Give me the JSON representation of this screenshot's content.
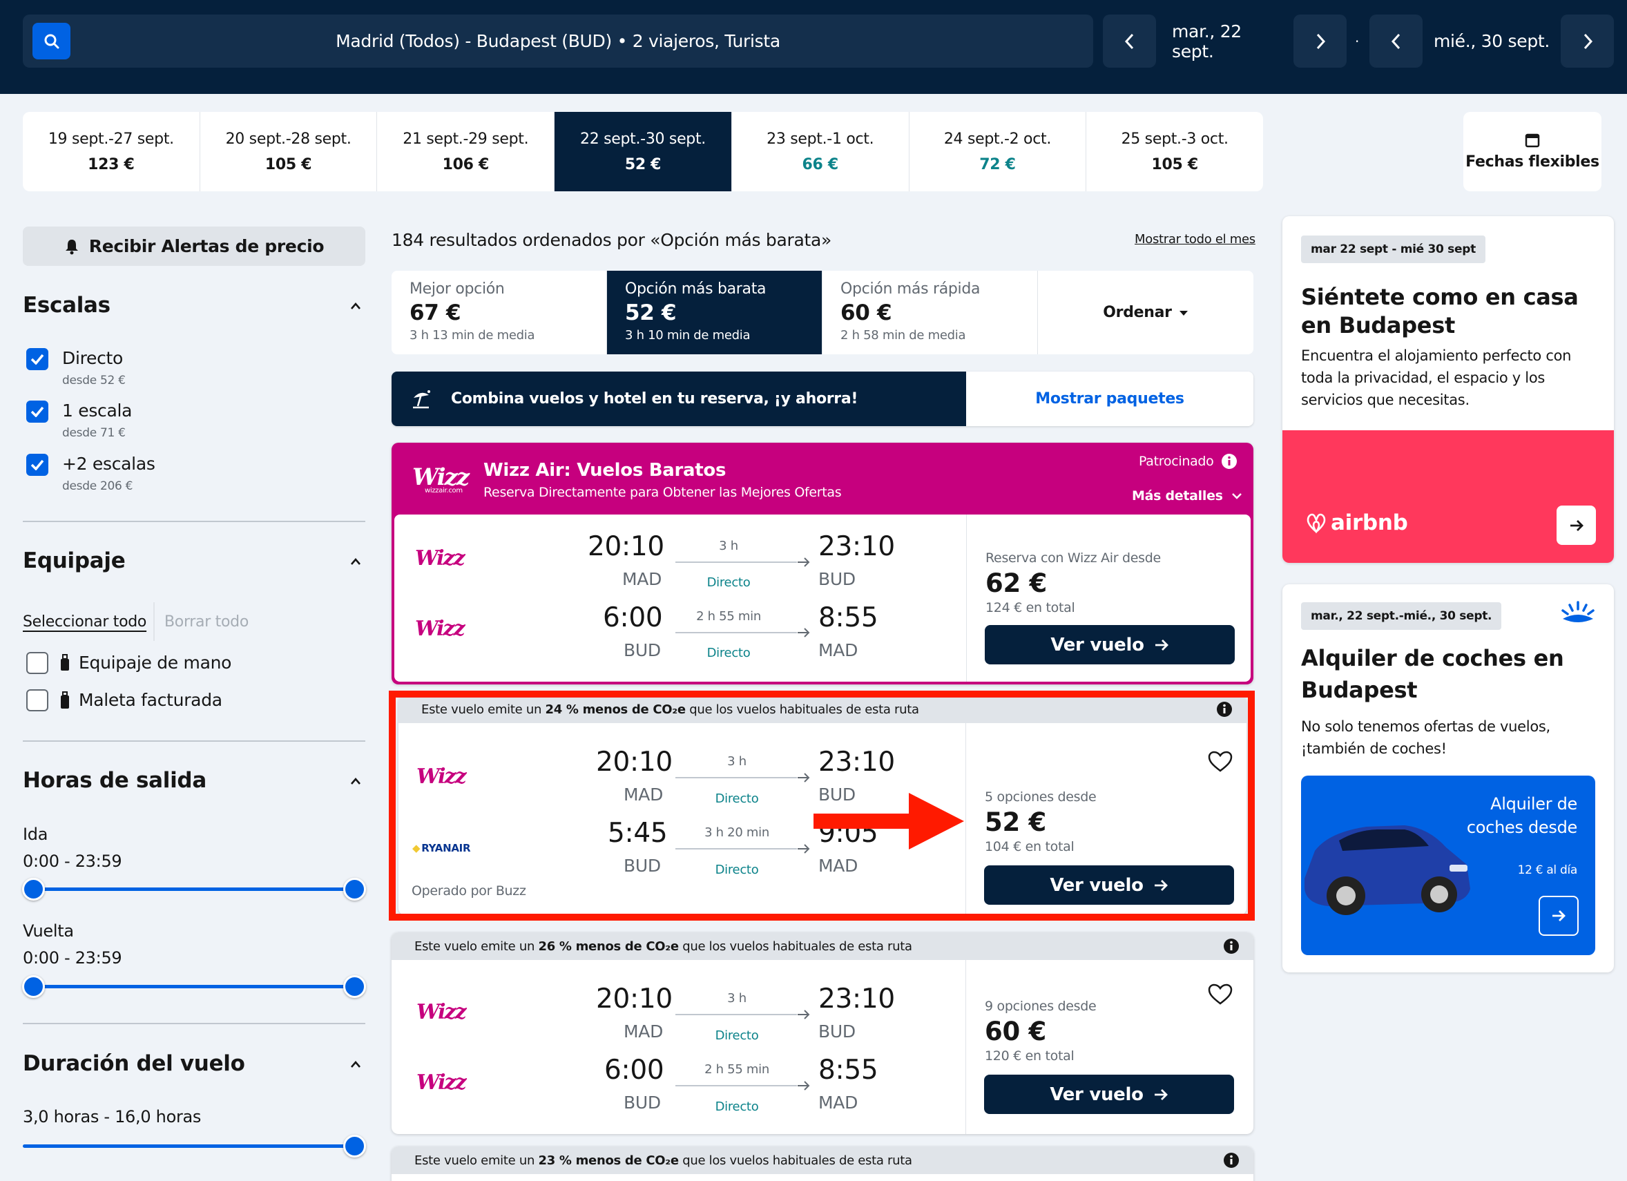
{
  "header": {
    "search_text": "Madrid (Todos) - Budapest (BUD)  •  2 viajeros, Turista",
    "depart_date": "mar., 22 sept.",
    "return_date": "mié., 30 sept.",
    "separator": "·"
  },
  "date_tabs": [
    {
      "range": "19 sept.-27 sept.",
      "price": "123 €",
      "selected": false,
      "cheap": false
    },
    {
      "range": "20 sept.-28 sept.",
      "price": "105 €",
      "selected": false,
      "cheap": false
    },
    {
      "range": "21 sept.-29 sept.",
      "price": "106 €",
      "selected": false,
      "cheap": false
    },
    {
      "range": "22 sept.-30 sept.",
      "price": "52 €",
      "selected": true,
      "cheap": false
    },
    {
      "range": "23 sept.-1 oct.",
      "price": "66 €",
      "selected": false,
      "cheap": true
    },
    {
      "range": "24 sept.-2 oct.",
      "price": "72 €",
      "selected": false,
      "cheap": true
    },
    {
      "range": "25 sept.-3 oct.",
      "price": "105 €",
      "selected": false,
      "cheap": false
    }
  ],
  "flexible_dates_label": "Fechas flexibles",
  "sidebar": {
    "alert_label": "Recibir Alertas de precio",
    "stops": {
      "title": "Escalas",
      "items": [
        {
          "label": "Directo",
          "sub": "desde 52 €",
          "checked": true
        },
        {
          "label": "1 escala",
          "sub": "desde 71 €",
          "checked": true
        },
        {
          "label": "+2 escalas",
          "sub": "desde 206 €",
          "checked": true
        }
      ]
    },
    "baggage": {
      "title": "Equipaje",
      "select_all": "Seleccionar todo",
      "clear_all": "Borrar todo",
      "items": [
        {
          "label": "Equipaje de mano",
          "checked": false
        },
        {
          "label": "Maleta facturada",
          "checked": false
        }
      ]
    },
    "departure_times": {
      "title": "Horas de salida",
      "outbound_label": "Ida",
      "outbound_range": "0:00 - 23:59",
      "return_label": "Vuelta",
      "return_range": "0:00 - 23:59"
    },
    "duration": {
      "title": "Duración del vuelo",
      "range": "3,0 horas - 16,0 horas"
    }
  },
  "results": {
    "summary": "184 resultados ordenados por «Opción más barata»",
    "show_month": "Mostrar todo el mes",
    "sort_tabs": [
      {
        "title": "Mejor opción",
        "price": "67 €",
        "sub": "3 h 13 min de media"
      },
      {
        "title": "Opción más barata",
        "price": "52 €",
        "sub": "3 h 10 min de media"
      },
      {
        "title": "Opción más rápida",
        "price": "60 €",
        "sub": "2 h 58 min de media"
      }
    ],
    "order_label": "Ordenar",
    "combo_text": "Combina vuelos y hotel en tu reserva, ¡y ahorra!",
    "combo_button": "Mostrar paquetes"
  },
  "sponsored": {
    "logo": "Wizz",
    "logo_sub": "wizzair.com",
    "title": "Wizz Air: Vuelos Baratos",
    "subtitle": "Reserva Directamente para Obtener las Mejores Ofertas",
    "tag": "Patrocinado",
    "more_details": "Más detalles",
    "outbound": {
      "dep": "20:10",
      "dep_ap": "MAD",
      "dur": "3 h",
      "type": "Directo",
      "arr": "23:10",
      "arr_ap": "BUD"
    },
    "inbound": {
      "dep": "6:00",
      "dep_ap": "BUD",
      "dur": "2 h 55 min",
      "type": "Directo",
      "arr": "8:55",
      "arr_ap": "MAD"
    },
    "price_from": "Reserva con Wizz Air desde",
    "price": "62 €",
    "total": "124 € en total",
    "button": "Ver vuelo"
  },
  "flights": [
    {
      "eco": [
        "Este vuelo emite un ",
        "24 % menos de CO₂e",
        " que los vuelos habituales de esta ruta"
      ],
      "airline1": "Wizz",
      "airline2": "RYANAIR",
      "outbound": {
        "dep": "20:10",
        "dep_ap": "MAD",
        "dur": "3 h",
        "type": "Directo",
        "arr": "23:10",
        "arr_ap": "BUD"
      },
      "inbound": {
        "dep": "5:45",
        "dep_ap": "BUD",
        "dur": "3 h 20 min",
        "type": "Directo",
        "arr": "9:05",
        "arr_ap": "MAD"
      },
      "operated": "Operado por Buzz",
      "options": "5 opciones desde",
      "price": "52 €",
      "total": "104 € en total",
      "button": "Ver vuelo"
    },
    {
      "eco": [
        "Este vuelo emite un ",
        "26 % menos de CO₂e",
        " que los vuelos habituales de esta ruta"
      ],
      "airline1": "Wizz",
      "airline2": "Wizz",
      "outbound": {
        "dep": "20:10",
        "dep_ap": "MAD",
        "dur": "3 h",
        "type": "Directo",
        "arr": "23:10",
        "arr_ap": "BUD"
      },
      "inbound": {
        "dep": "6:00",
        "dep_ap": "BUD",
        "dur": "2 h 55 min",
        "type": "Directo",
        "arr": "8:55",
        "arr_ap": "MAD"
      },
      "options": "9 opciones desde",
      "price": "60 €",
      "total": "120 € en total",
      "button": "Ver vuelo"
    },
    {
      "eco": [
        "Este vuelo emite un ",
        "23 % menos de CO₂e",
        " que los vuelos habituales de esta ruta"
      ]
    }
  ],
  "ads": {
    "airbnb": {
      "badge": "mar 22 sept - mié 30 sept",
      "title": "Siéntete como en casa en Budapest",
      "desc": "Encuentra el alojamiento perfecto con toda la privacidad, el espacio y los servicios que necesitas.",
      "brand": "airbnb"
    },
    "cars": {
      "badge": "mar., 22 sept.-mié., 30 sept.",
      "title": "Alquiler de coches en Budapest",
      "desc": "No solo tenemos ofertas de vuelos, ¡también de coches!",
      "promo": "Alquiler de coches desde",
      "promo_price": "12 € al día"
    }
  },
  "colors": {
    "navy": "#05203c",
    "blue": "#0062e3",
    "magenta": "#c6007e",
    "airbnb": "#ff385c",
    "highlight_red": "#ff1a00",
    "teal": "#0c838a"
  }
}
